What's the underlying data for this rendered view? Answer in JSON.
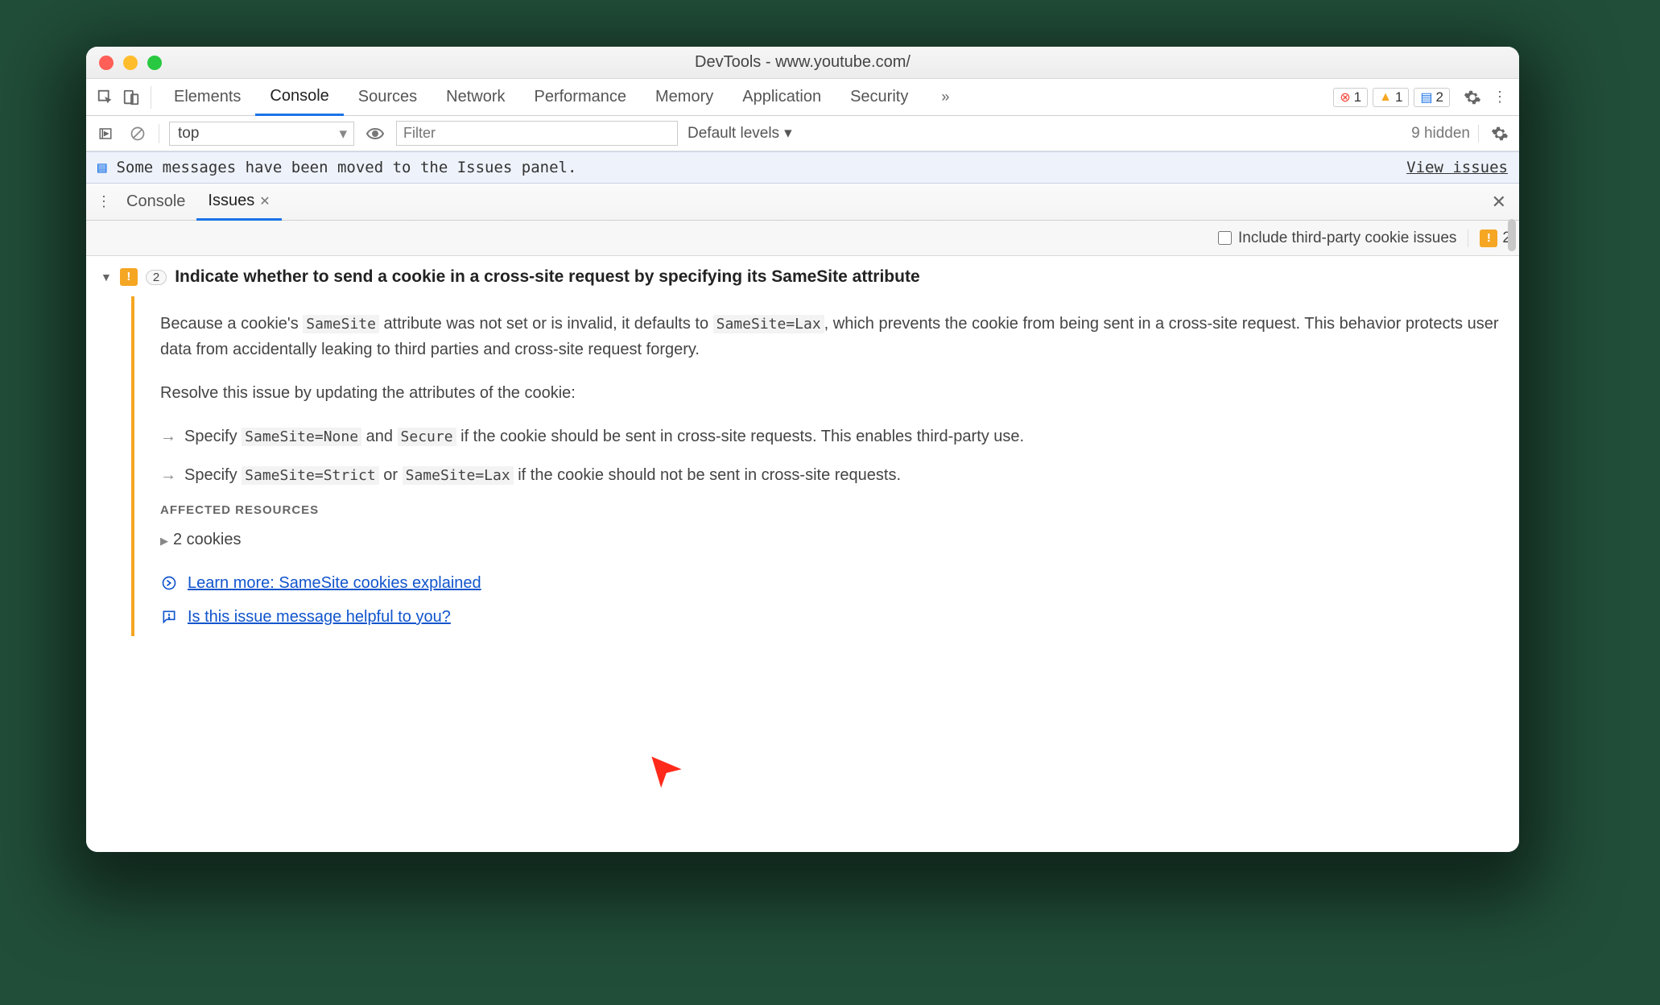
{
  "window": {
    "title_prefix": "DevTools",
    "title_url": "www.youtube.com/"
  },
  "tabs": {
    "items": [
      "Elements",
      "Console",
      "Sources",
      "Network",
      "Performance",
      "Memory",
      "Application",
      "Security"
    ],
    "active_index": 1
  },
  "badges": {
    "errors": "1",
    "warnings": "1",
    "messages": "2"
  },
  "filter": {
    "context": "top",
    "placeholder": "Filter",
    "levels": "Default levels",
    "hidden": "9 hidden"
  },
  "banner": {
    "text": "Some messages have been moved to the Issues panel.",
    "link": "View issues"
  },
  "drawer": {
    "tabs": [
      "Console",
      "Issues"
    ],
    "active_index": 1
  },
  "options": {
    "checkbox_label": "Include third-party cookie issues",
    "count": "2"
  },
  "issue": {
    "count": "2",
    "title": "Indicate whether to send a cookie in a cross-site request by specifying its SameSite attribute",
    "desc": {
      "p1a": "Because a cookie's ",
      "c1": "SameSite",
      "p1b": " attribute was not set or is invalid, it defaults to ",
      "c2": "SameSite=Lax",
      "p1c": ", which prevents the cookie from being sent in a cross-site request. This behavior protects user data from accidentally leaking to third parties and cross-site request forgery."
    },
    "resolve": "Resolve this issue by updating the attributes of the cookie:",
    "b1": {
      "a": "Specify ",
      "c1": "SameSite=None",
      "b": " and ",
      "c2": "Secure",
      "c": " if the cookie should be sent in cross-site requests. This enables third-party use."
    },
    "b2": {
      "a": "Specify ",
      "c1": "SameSite=Strict",
      "b": " or ",
      "c2": "SameSite=Lax",
      "c": " if the cookie should not be sent in cross-site requests."
    },
    "affected_header": "AFFECTED RESOURCES",
    "affected_item": "2 cookies",
    "learn_more": "Learn more: SameSite cookies explained",
    "feedback": "Is this issue message helpful to you?"
  }
}
